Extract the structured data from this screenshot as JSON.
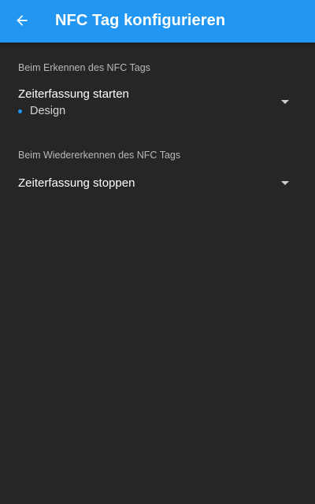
{
  "appbar": {
    "title": "NFC Tag konfigurieren",
    "back_icon": "arrow-left-icon",
    "background_color": "#2196f3"
  },
  "sections": [
    {
      "label": "Beim Erkennen des NFC Tags",
      "selected_value": "Zeiterfassung starten",
      "sub_items": [
        {
          "label": "Design",
          "dot_color": "#2196f3"
        }
      ]
    },
    {
      "label": "Beim Wiedererkennen des NFC Tags",
      "selected_value": "Zeiterfassung stoppen",
      "sub_items": []
    }
  ],
  "icons": {
    "dropdown": "caret-down-icon"
  }
}
